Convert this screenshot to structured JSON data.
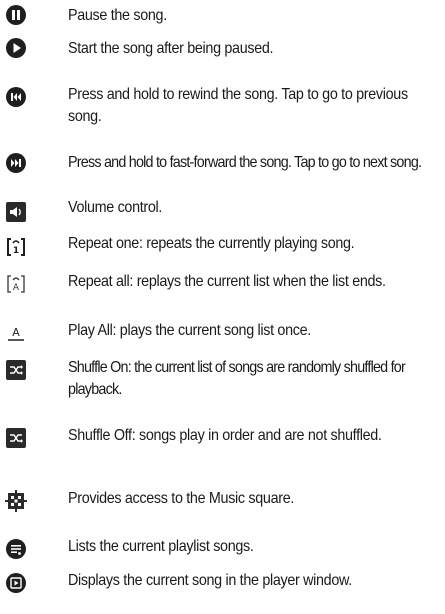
{
  "items": [
    {
      "icon": "pause-icon",
      "text": "Pause the song."
    },
    {
      "icon": "play-icon",
      "text": "Start the song after being paused."
    },
    {
      "icon": "rewind-icon",
      "text": "Press and hold to rewind the song. Tap to go to previous song."
    },
    {
      "icon": "fast-forward-icon",
      "text": "Press and hold to fast-forward the song. Tap to go to next song."
    },
    {
      "icon": "volume-icon",
      "text": "Volume control."
    },
    {
      "icon": "repeat-one-icon",
      "text": "Repeat one: repeats the currently playing song."
    },
    {
      "icon": "repeat-all-icon",
      "text": "Repeat all: replays the current list when the list ends."
    },
    {
      "icon": "play-all-icon",
      "text": "Play All: plays the current song list once."
    },
    {
      "icon": "shuffle-on-icon",
      "text": "Shuffle On: the current list of songs are randomly shuffled for playback."
    },
    {
      "icon": "shuffle-off-icon",
      "text": "Shuffle Off: songs play in order and are not shuffled."
    },
    {
      "icon": "music-square-icon",
      "text": "Provides access to the Music square."
    },
    {
      "icon": "playlist-icon",
      "text": "Lists the current playlist songs."
    },
    {
      "icon": "player-window-icon",
      "text": "Displays the current song in the player window."
    }
  ]
}
